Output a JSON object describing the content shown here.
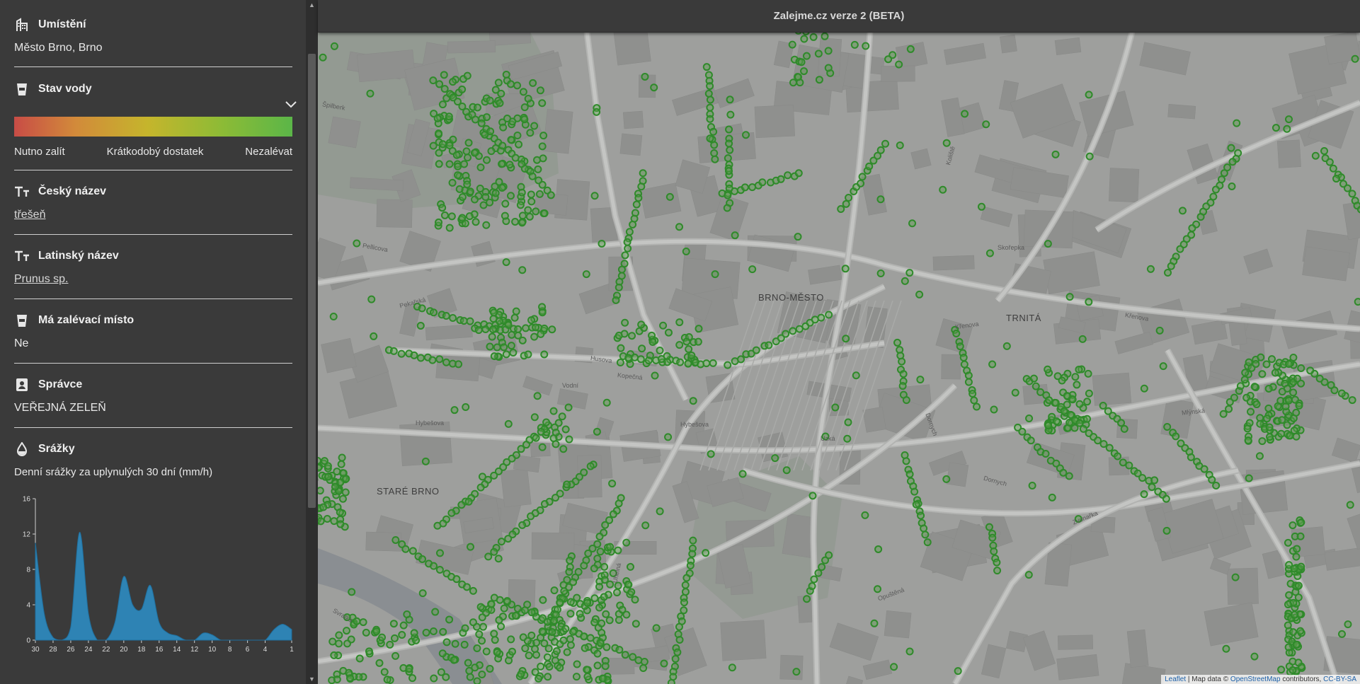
{
  "header": {
    "title": "Zalejme.cz verze 2 (BETA)"
  },
  "sidebar": {
    "location": {
      "icon": "building-icon",
      "label": "Umístění",
      "value": "Město Brno, Brno"
    },
    "water": {
      "icon": "cup-icon",
      "label": "Stav vody",
      "legend": [
        "Nutno zalít",
        "Krátkodobý dostatek",
        "Nezalévat"
      ],
      "gradient_colors": [
        "#c84c46",
        "#c5b52c",
        "#5bb648"
      ]
    },
    "czech_name": {
      "icon": "text-size-icon",
      "label": "Český název",
      "value": "třešeň"
    },
    "latin_name": {
      "icon": "text-size-icon",
      "label": "Latinský název",
      "value": "Prunus sp."
    },
    "watering_spot": {
      "icon": "cup-icon",
      "label": "Má zalévací místo",
      "value": "Ne"
    },
    "manager": {
      "icon": "badge-icon",
      "label": "Správce",
      "value": "VEŘEJNÁ ZELEŇ"
    },
    "rain": {
      "icon": "drop-icon",
      "label": "Srážky",
      "subtitle": "Denní srážky za uplynulých 30 dní (mm/h)"
    }
  },
  "chart_data": {
    "type": "area",
    "xlabel": "",
    "ylabel": "",
    "x_ticks": [
      "30",
      "28",
      "26",
      "24",
      "22",
      "20",
      "18",
      "16",
      "14",
      "12",
      "10",
      "8",
      "6",
      "4",
      "1"
    ],
    "y_ticks": [
      "0",
      "4",
      "8",
      "12",
      "16"
    ],
    "ylim": [
      0,
      16
    ],
    "xlim": [
      30,
      1
    ],
    "x": [
      30,
      29,
      28,
      27,
      26,
      25,
      24,
      23,
      22,
      21,
      20,
      19,
      18,
      17,
      16,
      15,
      14,
      13,
      12,
      11,
      10,
      9,
      8,
      7,
      6,
      5,
      4,
      3,
      2,
      1
    ],
    "values": [
      11,
      3,
      0.3,
      0,
      1.5,
      12.2,
      3,
      0,
      0,
      2,
      7.2,
      4,
      3.5,
      6.2,
      2,
      0.8,
      0.5,
      0,
      0,
      0.8,
      0.6,
      0,
      0,
      0,
      0,
      0,
      0,
      1.2,
      1.8,
      1.2
    ],
    "color": "#2e83b4"
  },
  "map": {
    "labels": [
      "BRNO-MĚSTO",
      "TRNITÁ",
      "STARÉ BRNO"
    ],
    "streets": [
      "Pekařská",
      "Husova",
      "Hybešova",
      "Křenova",
      "Koliště",
      "Úzká",
      "Dornych",
      "Zvonařka",
      "Opuštěná",
      "Uhelná",
      "Svratka",
      "Mlýnská",
      "Vodní",
      "Kopečná",
      "Špilberk",
      "Pellicova",
      "Skořepka",
      "Plotní"
    ],
    "marker_color": "#2f8a2a",
    "attribution": {
      "leaflet": "Leaflet",
      "mid": "| Map data ©",
      "osm": "OpenStreetMap",
      "contrib": "contributors,",
      "license": "CC-BY-SA"
    }
  }
}
